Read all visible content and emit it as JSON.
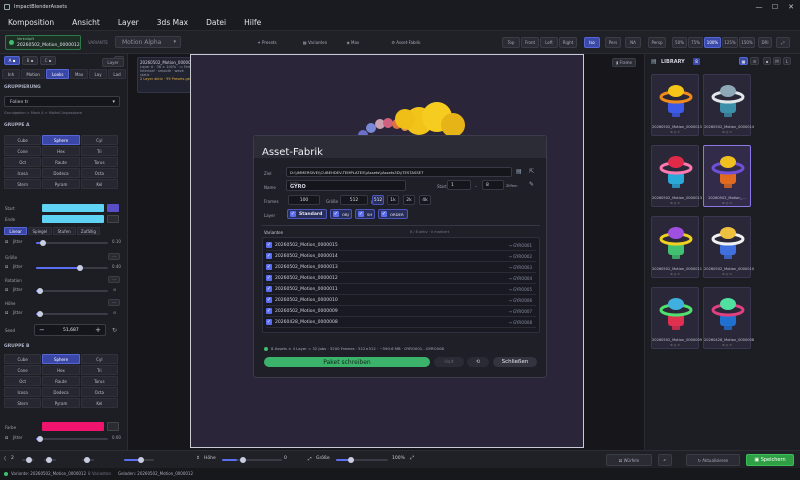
{
  "window": {
    "title": "ImpactBlenderAssets"
  },
  "menu": [
    "Komposition",
    "Ansicht",
    "Layer",
    "3ds Max",
    "Datei",
    "Hilfe"
  ],
  "toolbar": {
    "active_file": {
      "top": "Verknüpft",
      "name": "20260502_Motion_0000012"
    },
    "variant_label": "VARIANTE",
    "variant_value": "Motion Alpha",
    "center_tabs": [
      "Presets",
      "Varianten",
      "Max",
      "Asset-Fabrik"
    ],
    "view_buttons": [
      "Top",
      "Front",
      "Left",
      "Right",
      "Iso",
      "Pers",
      "NA",
      "Persp"
    ],
    "zoom_buttons": [
      "50%",
      "75%",
      "100%",
      "125%",
      "150%",
      "DRI"
    ],
    "active_view": "Iso",
    "active_zoom": "100%"
  },
  "left": {
    "layer_buttons": [
      "A",
      "B",
      "C"
    ],
    "tabs": [
      "Inh",
      "Motion",
      "Looks",
      "Max",
      "Lay",
      "Lad"
    ],
    "active_tab": "Looks",
    "grouping_label": "GRUPPIERUNG",
    "grouping_value": "Folien tr",
    "breadcrumb": "Grundgeben > Mesh A > Maltell Anpassbare",
    "groupA_label": "GRUPPE A",
    "shapesA": [
      "Cube",
      "Sphere",
      "Cyl",
      "Cone",
      "Hex",
      "Tri",
      "Oct",
      "Raute",
      "Torus",
      "Icosa",
      "Dodeca",
      "Octa",
      "Stern",
      "Pyram",
      "Kel"
    ],
    "activeShapeA": "Sphere",
    "start_label": "Start",
    "end_label": "Ende",
    "interp_tabs": [
      "Linear",
      "Spiegel",
      "Stufen",
      "Zufällig"
    ],
    "active_interp": "Linear",
    "jitter_label": "Jitter",
    "jitter_value": "0.10",
    "size_label": "Größe",
    "size_jitter_label": "Jitter",
    "size_jitter_value": "0.40",
    "rotation_label": "Rotation",
    "rot_jitter_label": "Jitter",
    "height_label": "Höhe",
    "height_jitter_label": "Jitter",
    "seed_label": "Seed",
    "seed_value": "51,687",
    "groupB_label": "GRUPPE B",
    "shapesB": [
      "Cube",
      "Sphere",
      "Cyl",
      "Cone",
      "Hex",
      "Tri",
      "Oct",
      "Raute",
      "Torus",
      "Icosa",
      "Dodeca",
      "Octa",
      "Stern",
      "Pyram",
      "Kel"
    ],
    "activeShapeB": "Sphere",
    "color_label": "Farbe",
    "color_jitter_label": "Jitter",
    "color_jitter_value": "0.00"
  },
  "viewport": {
    "info_title": "20260502_Motion_0000012",
    "info_lines": [
      "Layer A · 36 × 100% · ▭ Farbe tr",
      "Interleaf · smooth · wave",
      "static · ",
      "2 Layer aktiv · 99 Presets geladen"
    ],
    "layer_select": "Layer",
    "frame_button": "Frame"
  },
  "modal": {
    "title": "Asset-Fabrik",
    "target_label": "Ziel",
    "target_value": "D:\\\\IMMERSIVE\\\\CUBEHDEV-TEMPLATES\\\\Assets\\\\Assets3D\\\\TESTASSET",
    "name_label": "Name",
    "name_value": "GYRO",
    "name_hint": "Präfix",
    "start_label": "Start",
    "start_value": "1",
    "end_value": "8",
    "step_label": "Ziffern",
    "frames_label": "Frames",
    "frames_value": "100",
    "size_label": "Größe",
    "size_value": "512",
    "res_options": [
      "512",
      "1k",
      "2k",
      "4k"
    ],
    "active_res": "512",
    "layers_label": "Layer",
    "layer_chips": [
      "Standard",
      "OBJ",
      "SH",
      "ORDER"
    ],
    "variants_label": "Varianten",
    "variants_meta": "8 / 8 aktiv · 0 markiert",
    "variants": [
      {
        "name": "20260502_Motion_0000015",
        "code": "→ GYRO001"
      },
      {
        "name": "20260502_Motion_0000014",
        "code": "→ GYRO002"
      },
      {
        "name": "20260502_Motion_0000013",
        "code": "→ GYRO003"
      },
      {
        "name": "20260502_Motion_0000012",
        "code": "→ GYRO004"
      },
      {
        "name": "20260502_Motion_0000011",
        "code": "→ GYRO005"
      },
      {
        "name": "20260502_Motion_0000010",
        "code": "→ GYRO006"
      },
      {
        "name": "20260502_Motion_0000009",
        "code": "→ GYRO007"
      },
      {
        "name": "20260428_Motion_0000008",
        "code": "→ GYRO008"
      }
    ],
    "summary": "8 Assets × 4 Layer = 32 Jobs · 3200 Frames · 512×512 · ~590.6 MB · GYRO001…GYRO008",
    "primary_button": "Paket schreiben",
    "stop_button": "Halt",
    "pause_button": "⟲",
    "close_button": "Schließen"
  },
  "library": {
    "title": "LIBRARY",
    "count": "8",
    "items": [
      {
        "label": "20260502_Motion_0000015",
        "top": "#f5c518",
        "mid": "#3d5ae8",
        "ring": "#f08a1a"
      },
      {
        "label": "20260502_Motion_0000014",
        "top": "#8fa8b8",
        "mid": "#3c8fa8",
        "ring": "#e0e6ea"
      },
      {
        "label": "20260502_Motion_0000013",
        "top": "#e02a4a",
        "mid": "#2aa8d8",
        "ring": "#ff7ab0"
      },
      {
        "label": "20260502_Motion_...",
        "top": "#f0c020",
        "mid": "#e06a20",
        "ring": "#7050d8",
        "selected": true
      },
      {
        "label": "20260502_Motion_0000011",
        "top": "#a050e0",
        "mid": "#40c070",
        "ring": "#f0d020"
      },
      {
        "label": "20260502_Motion_0000010",
        "top": "#f0c040",
        "mid": "#4070e0",
        "ring": "#f0f0f0"
      },
      {
        "label": "20260502_Motion_0000009",
        "top": "#40b0e0",
        "mid": "#e03050",
        "ring": "#50e070"
      },
      {
        "label": "20260428_Motion_0000008",
        "top": "#50e0a0",
        "mid": "#2070d0",
        "ring": "#e04080"
      }
    ]
  },
  "bottom": {
    "frame_label": "2",
    "height_label": "Höhe",
    "height_value": "0",
    "size_label": "Größe",
    "size_value": "100%",
    "cube_button": "Würfeln",
    "undo_button": "↶",
    "refresh_button": "Aktualisieren",
    "save_button": "Speichern"
  },
  "status": {
    "variant": "Variante: 20260502_Motion_0000012",
    "items": "8 Varianten",
    "loaded": "Geladen: 20260502_Motion_0000012"
  },
  "colors": {
    "accent": "#5b6ef0",
    "start_color": "#5fd3f3",
    "end_color": "#5fd3f3",
    "groupB_color": "#f0146e",
    "save": "#2ea043"
  }
}
